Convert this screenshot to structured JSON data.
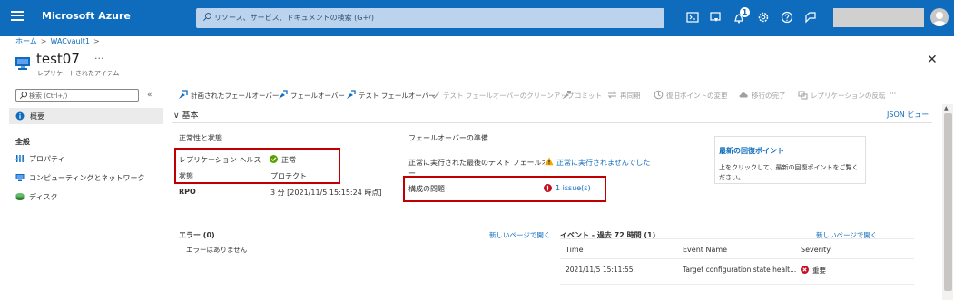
{
  "topbar": {
    "brand": "Microsoft Azure",
    "search_placeholder": "リソース、サービス、ドキュメントの検索 (G+/)",
    "notification_count": "1",
    "colors": {
      "bar": "#0f6cbd",
      "search": "#bbd3ed"
    }
  },
  "breadcrumb": {
    "home": "ホーム",
    "vault": "WACvault1",
    "sep": ">"
  },
  "header": {
    "title": "test07",
    "more": "···",
    "subtitle": "レプリケートされたアイテム",
    "close": "✕"
  },
  "sidebar": {
    "search_placeholder": "検索 (Ctrl+/)",
    "collapse": "«",
    "overview": "概要",
    "section": "全般",
    "items": [
      {
        "label": "プロパティ",
        "icon": "properties-icon"
      },
      {
        "label": "コンピューティングとネットワーク",
        "icon": "compute-network-icon"
      },
      {
        "label": "ディスク",
        "icon": "disk-icon"
      }
    ]
  },
  "toolbar": [
    {
      "label": "計画されたフェールオーバー",
      "enabled": true
    },
    {
      "label": "フェールオーバー",
      "enabled": true
    },
    {
      "label": "テスト フェールオーバー",
      "enabled": true
    },
    {
      "label": "テスト フェールオーバーのクリーンアップ",
      "enabled": false
    },
    {
      "label": "コミット",
      "enabled": false
    },
    {
      "label": "再同期",
      "enabled": false
    },
    {
      "label": "復旧ポイントの変更",
      "enabled": false
    },
    {
      "label": "移行の完了",
      "enabled": false
    },
    {
      "label": "レプリケーションの反転",
      "enabled": false
    },
    {
      "label": "···",
      "enabled": false
    }
  ],
  "essentials": {
    "toggle": "∨ 基本",
    "json_view": "JSON ビュー",
    "health": {
      "heading": "正常性と状態",
      "replication_health_label": "レプリケーション ヘルス",
      "replication_health_value": "正常",
      "status_label": "状態",
      "status_value": "プロテクト",
      "rpo_label": "RPO",
      "rpo_value": "3 分 [2021/11/5 15:15:24 時点]"
    },
    "failover": {
      "heading": "フェールオーバーの準備",
      "test_failover_label": "正常に実行された最後のテスト フェールオーバ",
      "test_failover_label_cont": "ー",
      "test_failover_value": "正常に実行されませんでした",
      "config_label": "構成の問題",
      "config_value": "1 issue(s)"
    },
    "recovery": {
      "title": "最新の回復ポイント",
      "desc": "上をクリックして、最新の回復ポイントをご覧ください。"
    }
  },
  "errors": {
    "title": "エラー (0)",
    "open_link": "新しいページで開く",
    "empty": "エラーはありません"
  },
  "events": {
    "title": "イベント - 過去 72 時間 (1)",
    "open_link": "新しいページで開く",
    "columns": [
      "Time",
      "Event Name",
      "Severity"
    ],
    "rows": [
      {
        "time": "2021/11/5 15:11:55",
        "name": "Target configuration state healt...",
        "severity": "重要"
      }
    ]
  },
  "colors": {
    "link": "#0f6cbd",
    "ok": "#57a300",
    "warning": "#f7a600",
    "error": "#c50f1f",
    "highlight_box": "#c00000"
  }
}
